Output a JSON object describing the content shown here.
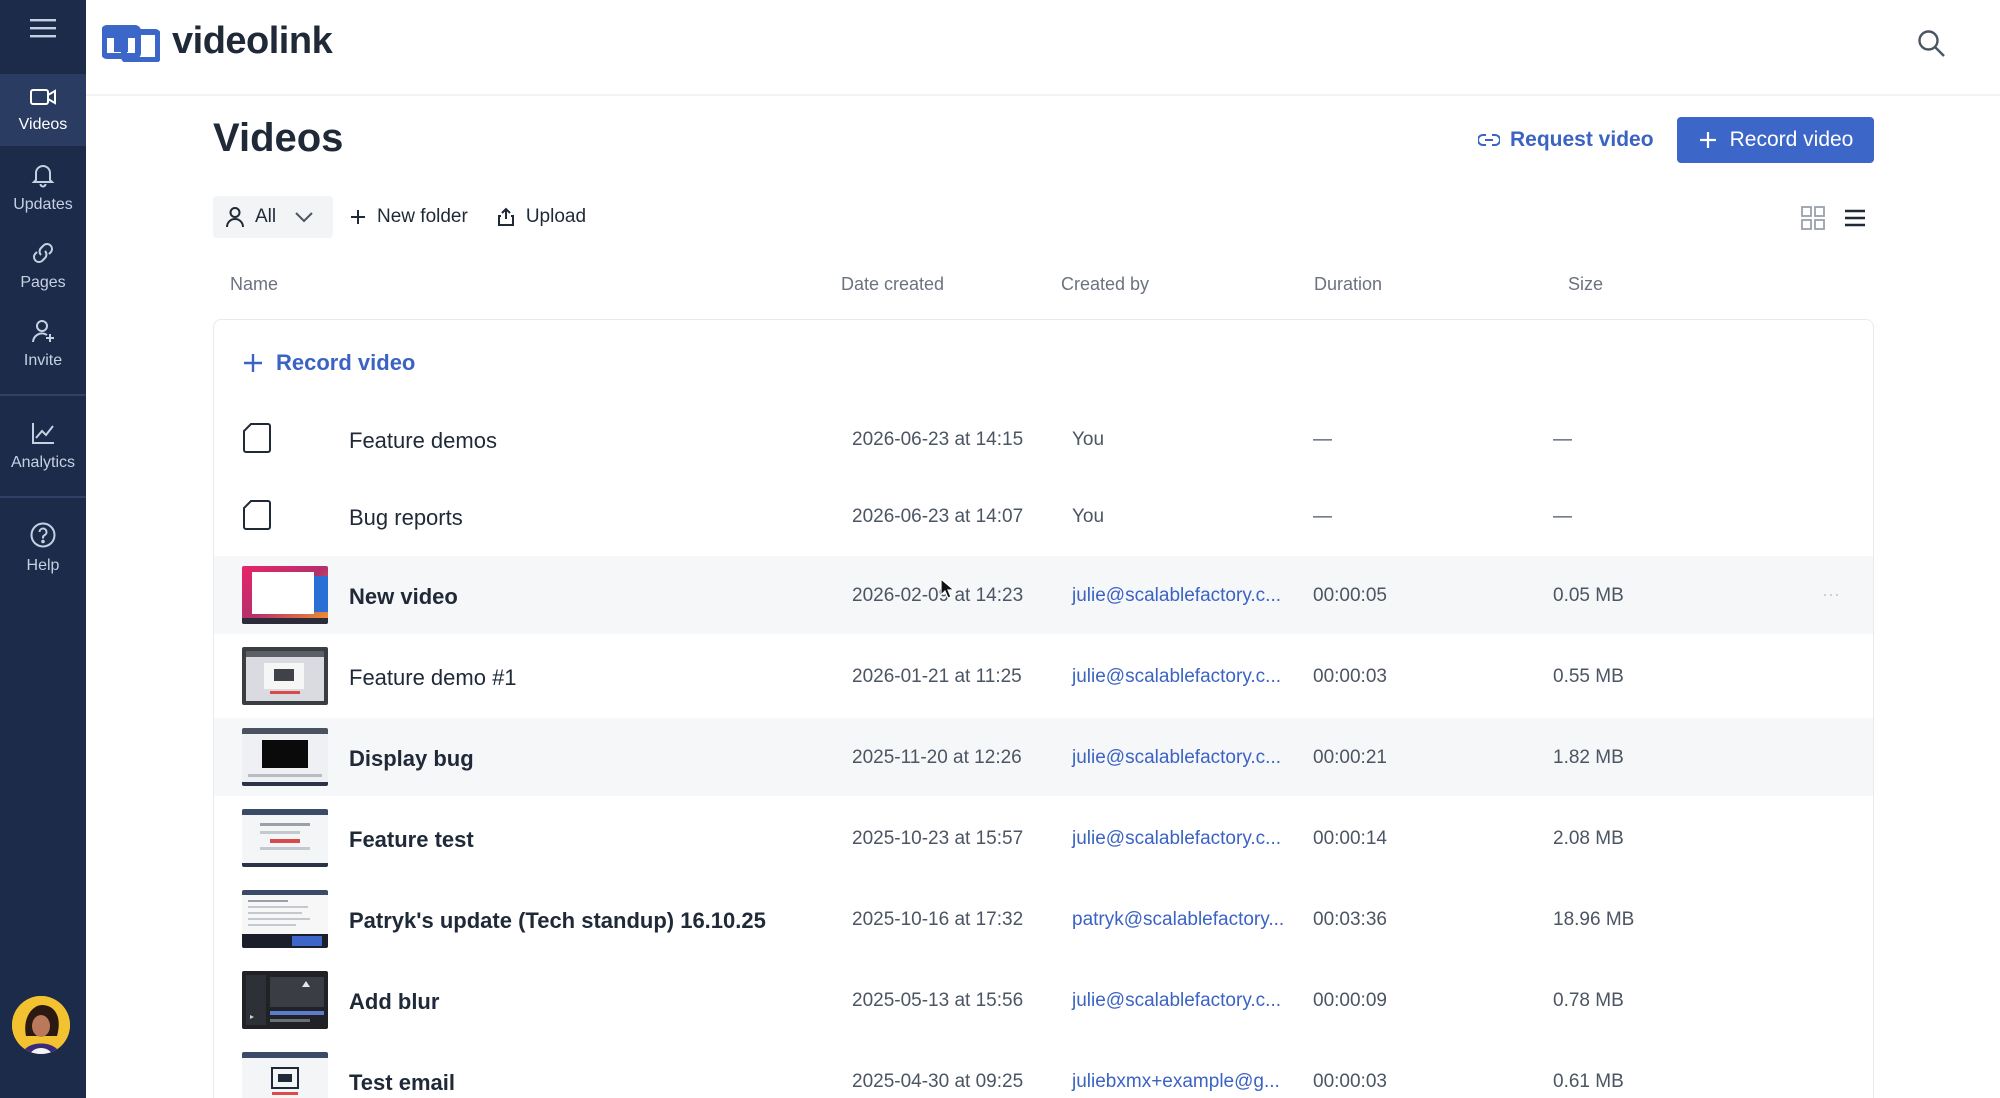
{
  "app": {
    "name": "videolink",
    "brand_color": "#3c66c8",
    "sidebar_color": "#1c2b4a"
  },
  "sidebar": {
    "items": [
      {
        "label": "Videos",
        "icon": "video-camera-icon",
        "active": true
      },
      {
        "label": "Updates",
        "icon": "bell-icon",
        "active": false
      },
      {
        "label": "Pages",
        "icon": "link-icon",
        "active": false
      },
      {
        "label": "Invite",
        "icon": "add-user-icon",
        "active": false
      },
      {
        "label": "Analytics",
        "icon": "chart-line-icon",
        "active": false
      },
      {
        "label": "Help",
        "icon": "question-circle-icon",
        "active": false
      }
    ]
  },
  "page": {
    "title": "Videos",
    "request_label": "Request video",
    "record_label": "Record video"
  },
  "toolbar": {
    "filter_value": "All",
    "new_folder_label": "New folder",
    "upload_label": "Upload"
  },
  "table": {
    "columns": [
      "Name",
      "Date created",
      "Created by",
      "Duration",
      "Size"
    ],
    "record_row_label": "Record video",
    "rows": [
      {
        "type": "folder",
        "name": "Feature demos",
        "date": "2026-06-23 at 14:15",
        "creator": "You",
        "duration": "—",
        "size": "—"
      },
      {
        "type": "folder",
        "name": "Bug reports",
        "date": "2026-06-23 at 14:07",
        "creator": "You",
        "duration": "—",
        "size": "—"
      },
      {
        "type": "video",
        "name": "New video",
        "date": "2026-02-09 at 14:23",
        "creator": "julie@scalablefactory.c...",
        "duration": "00:00:05",
        "size": "0.05 MB",
        "thumb": "gradient",
        "more": "···"
      },
      {
        "type": "video",
        "name": "Feature demo #1",
        "date": "2026-01-21 at 11:25",
        "creator": "julie@scalablefactory.c...",
        "duration": "00:00:03",
        "size": "0.55 MB",
        "thumb": "screen-gray"
      },
      {
        "type": "video",
        "name": "Display bug",
        "date": "2025-11-20 at 12:26",
        "creator": "julie@scalablefactory.c...",
        "duration": "00:00:21",
        "size": "1.82 MB",
        "thumb": "screen-black"
      },
      {
        "type": "video",
        "name": "Feature test",
        "date": "2025-10-23 at 15:57",
        "creator": "julie@scalablefactory.c...",
        "duration": "00:00:14",
        "size": "2.08 MB",
        "thumb": "screen-white"
      },
      {
        "type": "video",
        "name": "Patryk's update (Tech standup) 16.10.25",
        "date": "2025-10-16 at 17:32",
        "creator": "patryk@scalablefactory...",
        "duration": "00:03:36",
        "size": "18.96 MB",
        "thumb": "screen-doc"
      },
      {
        "type": "video",
        "name": "Add blur",
        "date": "2025-05-13 at 15:56",
        "creator": "julie@scalablefactory.c...",
        "duration": "00:00:09",
        "size": "0.78 MB",
        "thumb": "screen-dark"
      },
      {
        "type": "video",
        "name": "Test email",
        "date": "2025-04-30 at 09:25",
        "creator": "juliebxmx+example@g...",
        "duration": "00:00:03",
        "size": "0.61 MB",
        "thumb": "screen-white"
      }
    ]
  }
}
